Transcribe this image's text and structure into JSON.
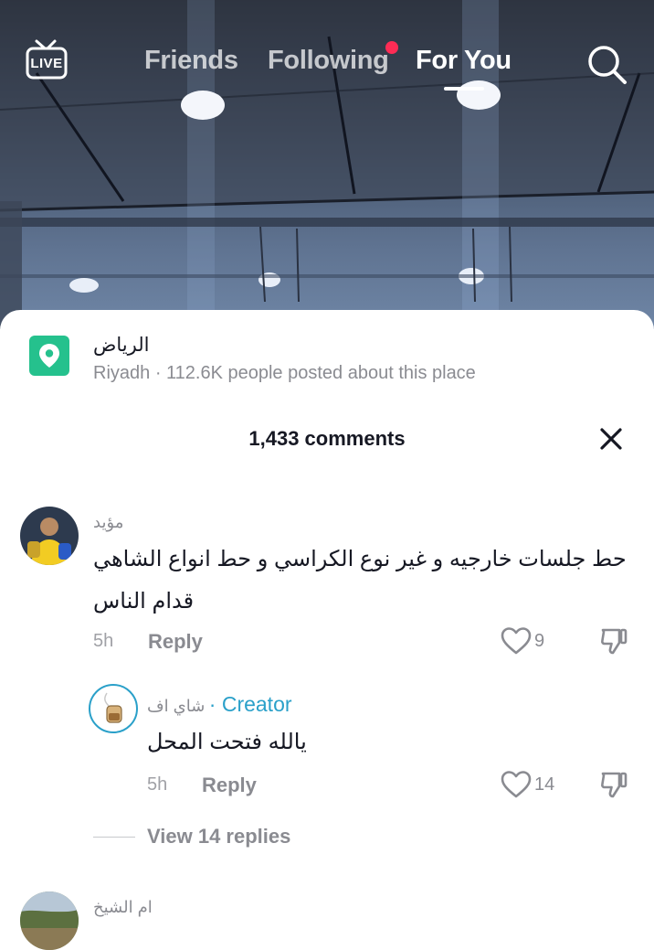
{
  "top_nav": {
    "live_label": "LIVE",
    "tabs": [
      {
        "label": "Friends"
      },
      {
        "label": "Following"
      },
      {
        "label": "For You"
      }
    ],
    "active_tab": "For You",
    "following_has_notification": true,
    "accent_color": "#fe2c55"
  },
  "place": {
    "name": "الرياض",
    "subtitle": "Riyadh · 112.6K people posted about this place",
    "icon": "location-pin-icon",
    "icon_color": "#25c18d"
  },
  "comments_panel": {
    "count_label": "1,433 comments"
  },
  "comments": [
    {
      "username": "مؤيد",
      "text_line1": "حط جلسات خارجيه و غير نوع الكراسي و حط انواع الشاهي",
      "text_line2": "قدام الناس",
      "time": "5h",
      "reply_label": "Reply",
      "likes": "9"
    },
    {
      "username": "شاي اف",
      "creator_label": "· Creator",
      "text": "يالله فتحت المحل",
      "time": "5h",
      "reply_label": "Reply",
      "likes": "14",
      "is_reply": true
    },
    {
      "username": "ام الشيخ"
    }
  ],
  "view_replies_label": "View 14 replies"
}
